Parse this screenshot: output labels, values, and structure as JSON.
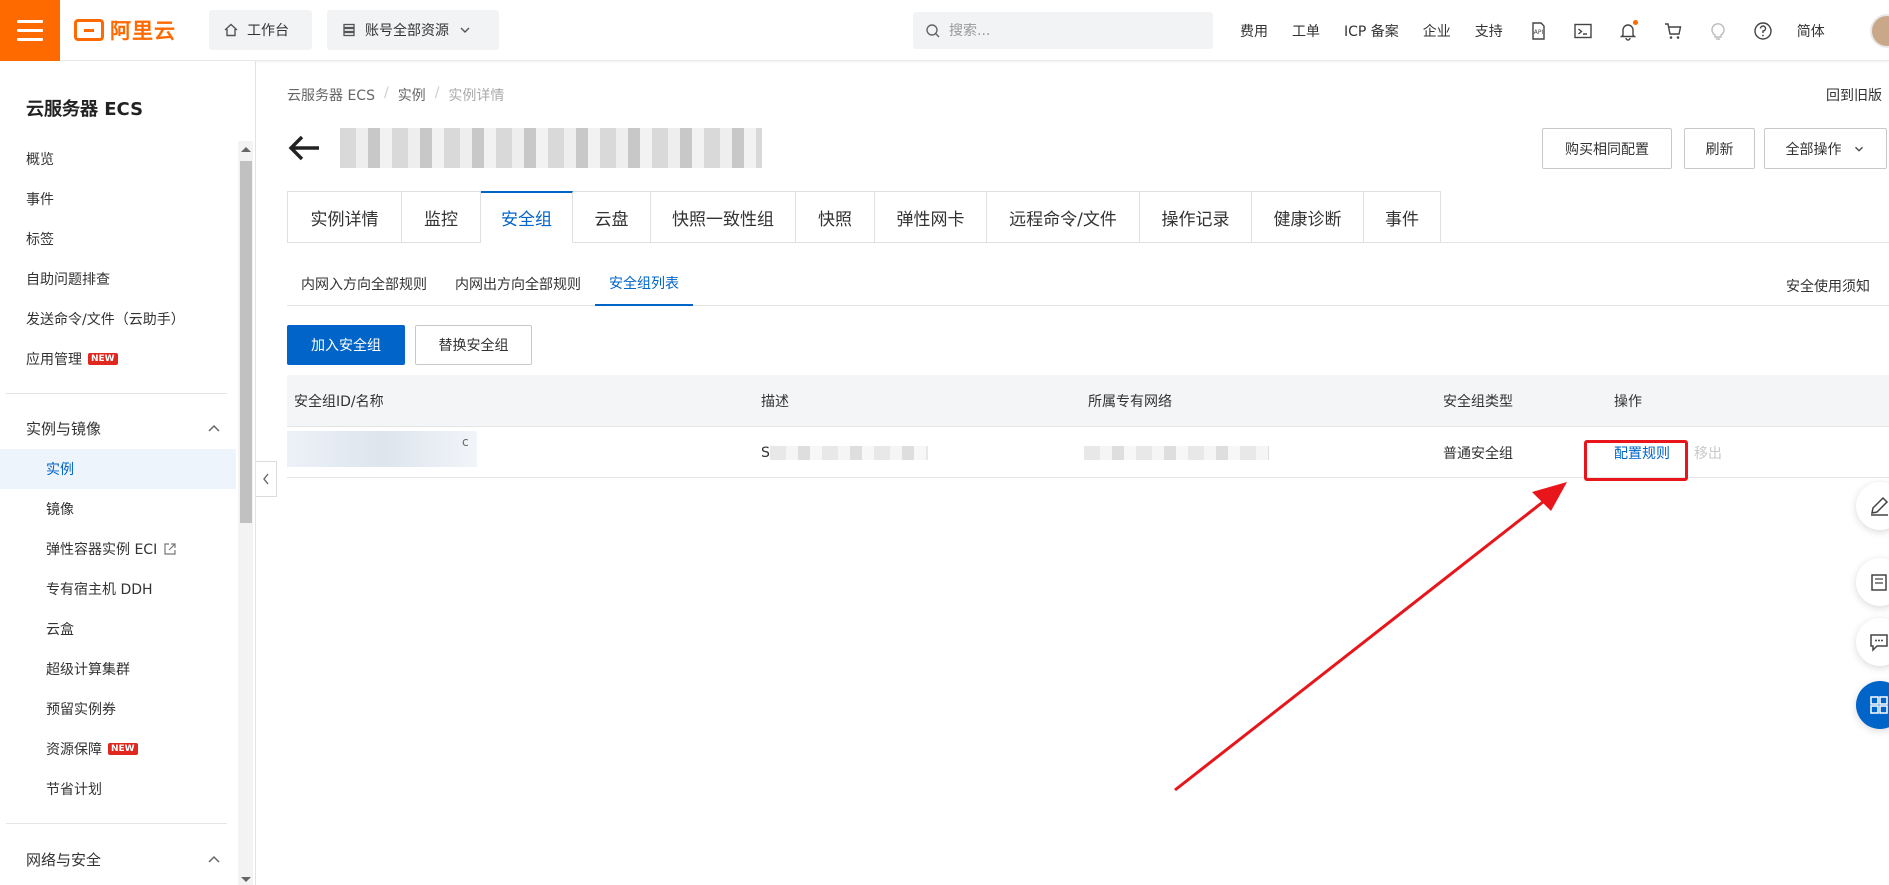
{
  "brand": {
    "logo_text": "阿里云",
    "accent": "#ff6a00"
  },
  "header": {
    "workbench_label": "工作台",
    "resources_label": "账号全部资源",
    "search_placeholder": "搜索...",
    "nav": [
      "费用",
      "工单",
      "ICP 备案",
      "企业",
      "支持"
    ],
    "language": "简体",
    "icons": [
      "api-icon",
      "terminal-icon",
      "bell-icon",
      "cart-icon",
      "lightbulb-icon",
      "help-icon"
    ]
  },
  "sidebar": {
    "title": "云服务器 ECS",
    "items": [
      {
        "label": "概览"
      },
      {
        "label": "事件"
      },
      {
        "label": "标签"
      },
      {
        "label": "自助问题排查"
      },
      {
        "label": "发送命令/文件（云助手）"
      },
      {
        "label": "应用管理",
        "badge": "NEW"
      }
    ],
    "group_instances": {
      "label": "实例与镜像",
      "items": [
        {
          "label": "实例"
        },
        {
          "label": "镜像"
        },
        {
          "label": "弹性容器实例 ECI"
        },
        {
          "label": "专有宿主机 DDH"
        },
        {
          "label": "云盒"
        },
        {
          "label": "超级计算集群"
        },
        {
          "label": "预留实例券"
        },
        {
          "label": "资源保障",
          "badge": "NEW"
        },
        {
          "label": "节省计划"
        }
      ]
    },
    "group_network": {
      "label": "网络与安全"
    }
  },
  "breadcrumb": [
    "云服务器 ECS",
    "实例",
    "实例详情"
  ],
  "old_version_link": "回到旧版",
  "actions": {
    "buy_same": "购买相同配置",
    "refresh": "刷新",
    "all_actions": "全部操作"
  },
  "tabs": [
    "实例详情",
    "监控",
    "安全组",
    "云盘",
    "快照一致性组",
    "快照",
    "弹性网卡",
    "远程命令/文件",
    "操作记录",
    "健康诊断",
    "事件"
  ],
  "active_tab": "安全组",
  "subtabs": [
    "内网入方向全部规则",
    "内网出方向全部规则",
    "安全组列表"
  ],
  "active_subtab": "安全组列表",
  "security_notice": "安全使用须知",
  "buttons": {
    "join": "加入安全组",
    "replace": "替换安全组"
  },
  "table": {
    "columns": [
      "安全组ID/名称",
      "描述",
      "所属专有网络",
      "安全组类型",
      "操作"
    ],
    "rows": [
      {
        "id_suffix": "c",
        "desc_prefix": "S",
        "type": "普通安全组",
        "op_config": "配置规则",
        "op_remove": "移出"
      }
    ]
  },
  "colors": {
    "primary": "#0064c8",
    "annotation": "#e8161a"
  }
}
